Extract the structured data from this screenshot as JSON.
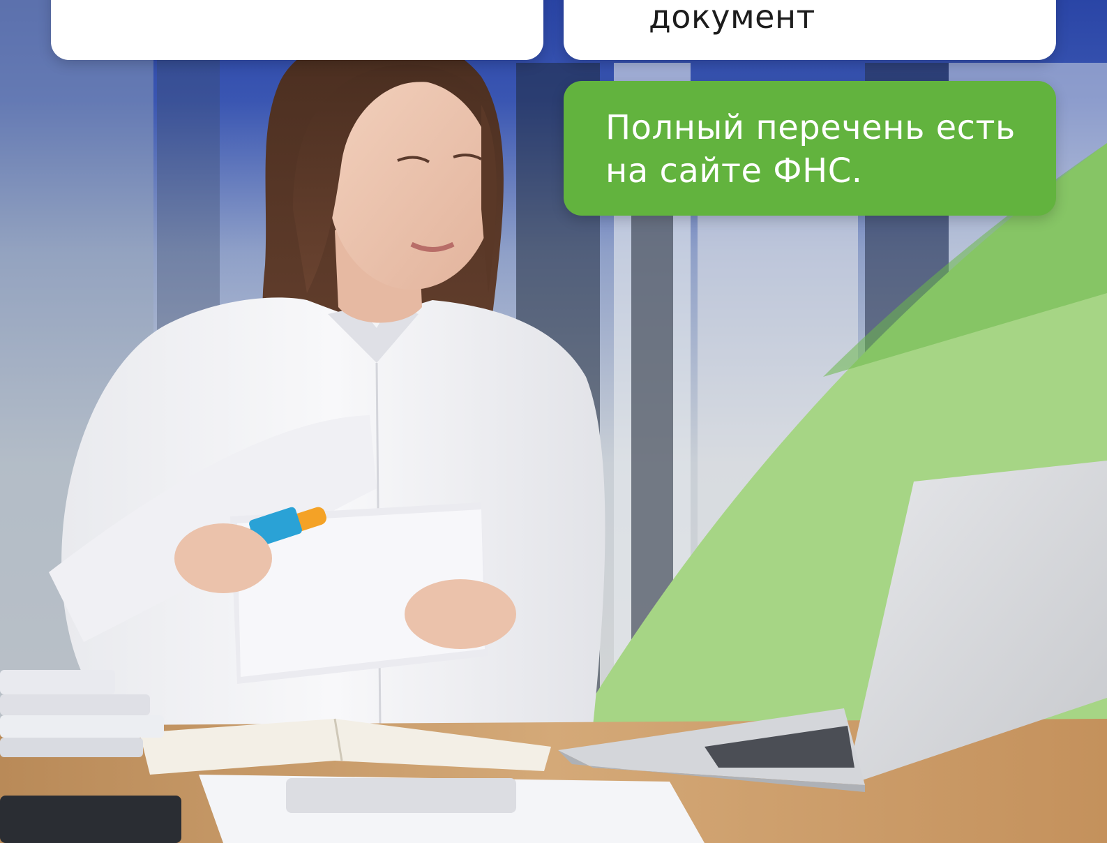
{
  "top_right_card": {
    "text": "документ"
  },
  "green_card": {
    "text": "Полный перечень есть на сайте ФНС."
  },
  "colors": {
    "blue_top": "#2c46a8",
    "green_accent": "#62b33e",
    "green_swoosh": "#a6d585",
    "card_white": "#ffffff",
    "wood": "#c99a64"
  }
}
